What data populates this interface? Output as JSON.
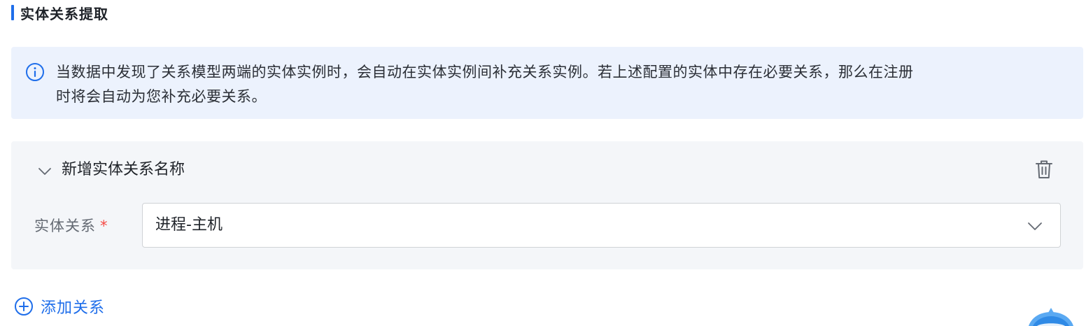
{
  "section": {
    "title": "实体关系提取"
  },
  "info": {
    "icon": "info-circle-icon",
    "text_line1": "当数据中发现了关系模型两端的实体实例时，会自动在实体实例间补充关系实例。若上述配置的实体中存在必要关系，那么在注册",
    "text_line2": "时将会自动为您补充必要关系。"
  },
  "relation_panel": {
    "title": "新增实体关系名称",
    "collapse_icon": "chevron-down-icon",
    "delete_icon": "trash-icon",
    "field_label": "实体关系",
    "required_mark": "*",
    "select_value": "进程-主机",
    "select_icon": "chevron-down-icon"
  },
  "add_relation": {
    "label": "添加关系",
    "icon": "plus-circle-icon"
  },
  "colors": {
    "accent": "#1f6eea",
    "info_bg": "#ecf2fd",
    "panel_bg": "#f4f6f9",
    "required": "#f54a45"
  }
}
